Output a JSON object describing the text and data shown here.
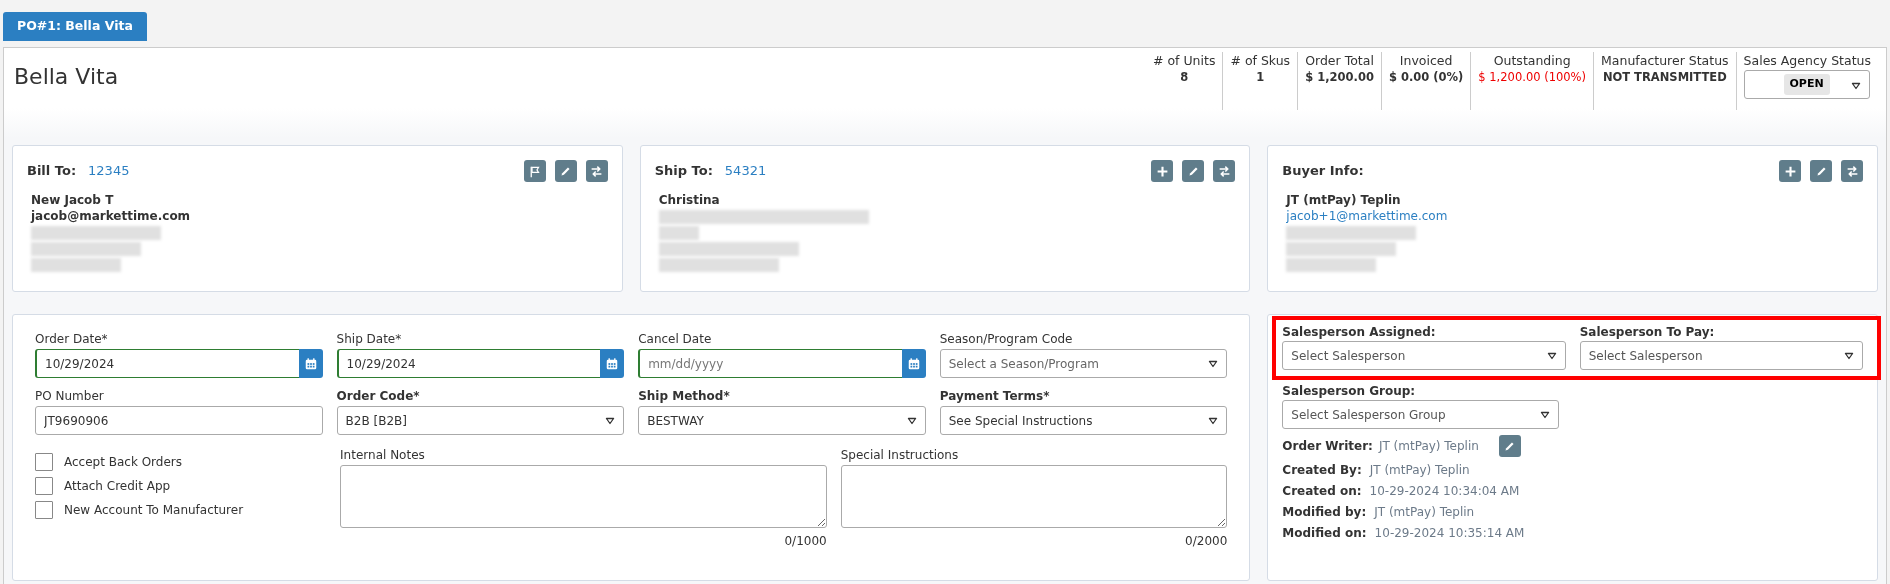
{
  "tabs": [
    {
      "label": "PO#1: Bella Vita",
      "selected": true
    }
  ],
  "title": "Bella Vita",
  "stats": [
    {
      "label": "# of Units",
      "value": "8",
      "kind": "text"
    },
    {
      "label": "# of Skus",
      "value": "1",
      "kind": "text"
    },
    {
      "label": "Order Total",
      "value": "$ 1,200.00",
      "kind": "text"
    },
    {
      "label": "Invoiced",
      "value": "$ 0.00 (0%)",
      "kind": "text"
    },
    {
      "label": "Outstanding",
      "value": "$ 1,200.00 (100%)",
      "kind": "alert"
    },
    {
      "label": "Manufacturer Status",
      "value": "NOT TRANSMITTED",
      "kind": "text"
    },
    {
      "label": "Sales Agency Status",
      "value": "OPEN",
      "kind": "select"
    }
  ],
  "address_cards": [
    {
      "title": "Bill To:",
      "code": "12345",
      "actions": [
        {
          "kind": "flag"
        },
        {
          "kind": "edit"
        },
        {
          "kind": "swap"
        }
      ],
      "lines": [
        {
          "text": "New Jacob T",
          "kind": "bold"
        },
        {
          "text": "jacob@markettime.com",
          "kind": "bold"
        }
      ],
      "redacted": true
    },
    {
      "title": "Ship To:",
      "code": "54321",
      "actions": [
        {
          "kind": "add"
        },
        {
          "kind": "edit"
        },
        {
          "kind": "swap"
        }
      ],
      "lines": [
        {
          "text": "Christina",
          "kind": "bold"
        }
      ],
      "redacted": true
    },
    {
      "title": "Buyer Info:",
      "actions": [
        {
          "kind": "add"
        },
        {
          "kind": "edit"
        },
        {
          "kind": "swap"
        }
      ],
      "lines": [
        {
          "text": "JT (mtPay) Teplin",
          "kind": "bold"
        },
        {
          "text": "jacob+1@markettime.com",
          "kind": "link"
        }
      ],
      "redacted": true
    }
  ],
  "form_fields": [
    {
      "label": "Order Date*",
      "bold": false,
      "kind": "date",
      "value": "10/29/2024",
      "validated": true
    },
    {
      "label": "Ship Date*",
      "bold": false,
      "kind": "date",
      "value": "10/29/2024",
      "validated": true
    },
    {
      "label": "Cancel Date",
      "bold": false,
      "kind": "date",
      "placeholder": "mm/dd/yyyy",
      "validated": true
    },
    {
      "label": "Season/Program Code",
      "bold": false,
      "kind": "select",
      "placeholder": "Select a Season/Program"
    },
    {
      "label": "PO Number",
      "bold": false,
      "kind": "text",
      "value": "JT9690906"
    },
    {
      "label": "Order Code*",
      "bold": true,
      "kind": "select",
      "value": "B2B [B2B]"
    },
    {
      "label": "Ship Method*",
      "bold": true,
      "kind": "select",
      "value": "BESTWAY"
    },
    {
      "label": "Payment Terms*",
      "bold": true,
      "kind": "select",
      "value": "See Special Instructions"
    }
  ],
  "checkboxes": [
    {
      "label": "Accept Back Orders",
      "checked": false
    },
    {
      "label": "Attach Credit App",
      "checked": false
    },
    {
      "label": "New Account To Manufacturer",
      "checked": false
    }
  ],
  "notes": [
    {
      "label": "Internal Notes",
      "counter": "0/1000"
    },
    {
      "label": "Special Instructions",
      "counter": "0/2000"
    }
  ],
  "salesperson": {
    "highlighted": true,
    "selects": [
      {
        "label": "Salesperson Assigned:",
        "placeholder": "Select Salesperson"
      },
      {
        "label": "Salesperson To Pay:",
        "placeholder": "Select Salesperson"
      }
    ],
    "group": {
      "label": "Salesperson Group:",
      "placeholder": "Select Salesperson Group"
    },
    "order_writer": {
      "label": "Order Writer:",
      "value": "JT (mtPay) Teplin"
    },
    "meta": [
      {
        "label": "Created By:",
        "value": "JT (mtPay) Teplin"
      },
      {
        "label": "Created on:",
        "value": "10-29-2024 10:34:04 AM"
      },
      {
        "label": "Modified by:",
        "value": "JT (mtPay) Teplin"
      },
      {
        "label": "Modified on:",
        "value": "10-29-2024 10:35:14 AM"
      }
    ]
  }
}
